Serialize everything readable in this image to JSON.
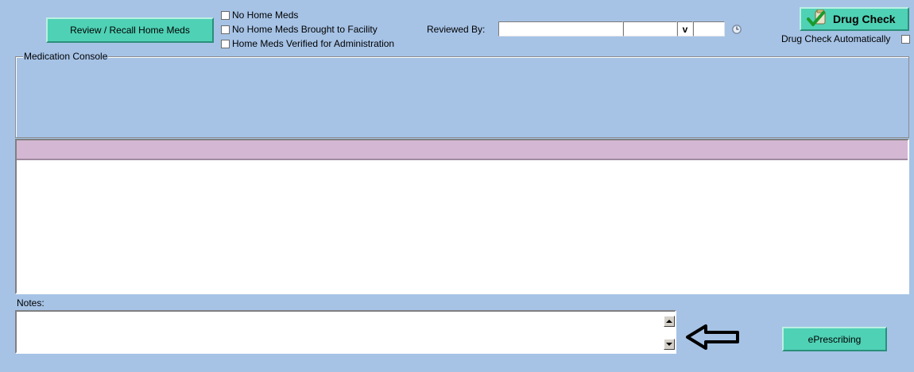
{
  "top": {
    "review_button": "Review / Recall Home Meds",
    "checkbox_no_home_meds": "No Home Meds",
    "checkbox_not_brought": "No Home Meds Brought to Facility",
    "checkbox_verified": "Home Meds Verified for Administration",
    "reviewed_by_label": "Reviewed By:",
    "reviewed_by_value": "",
    "reviewed_by_extra": "",
    "date_value": "",
    "dropdown_glyph": "v",
    "drug_check_button": "Drug Check",
    "drug_check_auto_label": "Drug Check Automatically"
  },
  "console": {
    "title": "Medication Console"
  },
  "notes": {
    "label": "Notes:",
    "value": ""
  },
  "eprescribing_button": "ePrescribing",
  "colors": {
    "background": "#a6c3e6",
    "button_teal": "#4fd1b5",
    "grid_header": "#d4b7d3"
  },
  "icons": {
    "drug_check": "checkmark-icon",
    "reset": "refresh-icon",
    "arrow": "left-arrow-icon"
  }
}
